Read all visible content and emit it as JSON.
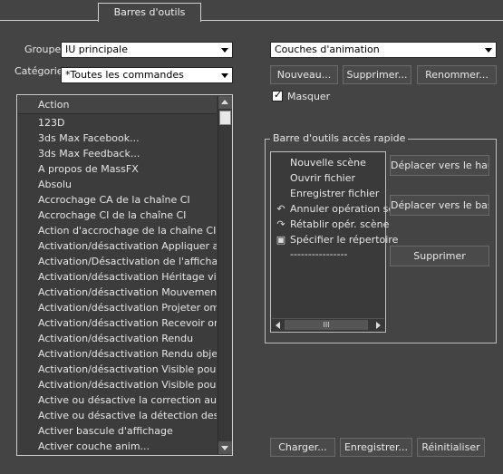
{
  "tab": {
    "label": "Barres d'outils"
  },
  "groupe": {
    "label": "Groupe:",
    "value": "IU principale"
  },
  "categorie": {
    "label": "Catégorie:",
    "value": "*Toutes les commandes"
  },
  "action_list": {
    "header": "Action",
    "rows": [
      "123D",
      "3ds Max Facebook...",
      "3ds Max Feedback...",
      "A propos de MassFX",
      "Absolu",
      "Accrochage CA de la chaîne CI",
      "Accrochage CI de la chaîne CI",
      "Action d'accrochage de la chaîne CI",
      "Activation/désactivation Appliquer at...",
      "Activation/Désactivation de l'affichag...",
      "Activation/désactivation Héritage visi...",
      "Activation/désactivation Mouvement ...",
      "Activation/désactivation Projeter omb...",
      "Activation/désactivation Recevoir om...",
      "Activation/désactivation Rendu",
      "Activation/désactivation Rendu objet...",
      "Activation/désactivation Visible pour l...",
      "Activation/désactivation Visible pour l...",
      "Active ou désactive la correction auto...",
      "Active ou désactive la détection des ...",
      "Activer bascule d'affichage",
      "Activer couche anim..."
    ]
  },
  "toolbar_select": {
    "value": "Couches d'animation"
  },
  "buttons": {
    "nouveau": "Nouveau...",
    "supprimer_top": "Supprimer...",
    "renommer": "Renommer...",
    "deplacer_haut": "Déplacer vers le haut",
    "deplacer_bas": "Déplacer vers le bas",
    "supprimer": "Supprimer",
    "charger": "Charger...",
    "enregistrer": "Enregistrer...",
    "reinitialiser": "Réinitialiser"
  },
  "masquer": {
    "label": "Masquer",
    "checked": true
  },
  "quick_access": {
    "title": "Barre d'outils accès rapide",
    "items": [
      {
        "label": "Nouvelle scène",
        "icon": ""
      },
      {
        "label": "Ouvrir fichier",
        "icon": ""
      },
      {
        "label": "Enregistrer fichier",
        "icon": ""
      },
      {
        "label": "Annuler opération scè",
        "icon": "undo-icon"
      },
      {
        "label": "Rétablir opér. scène",
        "icon": "redo-icon"
      },
      {
        "label": "Spécifier le répertoire",
        "icon": "folder-project-icon"
      },
      {
        "label": "----------------",
        "icon": ""
      }
    ],
    "hscroll_thumb": "III"
  }
}
